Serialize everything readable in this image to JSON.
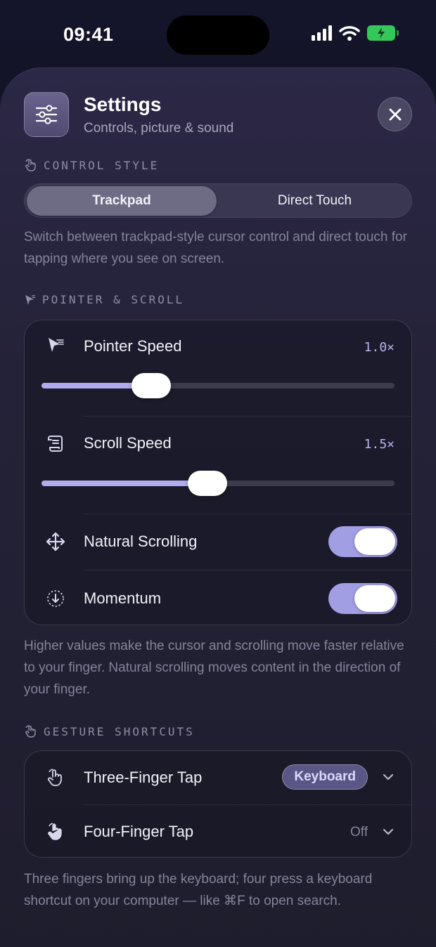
{
  "status_bar": {
    "time": "09:41"
  },
  "header": {
    "title": "Settings",
    "subtitle": "Controls, picture & sound"
  },
  "control_style": {
    "label": "CONTROL STYLE",
    "options": [
      "Trackpad",
      "Direct Touch"
    ],
    "selected": "Trackpad",
    "help": "Switch between trackpad-style cursor control and direct touch for tapping where you see on screen."
  },
  "pointer_scroll": {
    "label": "POINTER & SCROLL",
    "pointer_speed": {
      "label": "Pointer Speed",
      "value": "1.0×",
      "fraction": 0.31
    },
    "scroll_speed": {
      "label": "Scroll Speed",
      "value": "1.5×",
      "fraction": 0.47
    },
    "natural_scrolling": {
      "label": "Natural Scrolling",
      "on": true
    },
    "momentum": {
      "label": "Momentum",
      "on": true
    },
    "help": "Higher values make the cursor and scrolling move faster relative to your finger. Natural scrolling moves content in the direction of your finger."
  },
  "gesture_shortcuts": {
    "label": "GESTURE SHORTCUTS",
    "three_finger": {
      "label": "Three-Finger Tap",
      "value": "Keyboard"
    },
    "four_finger": {
      "label": "Four-Finger Tap",
      "value": "Off"
    },
    "help": "Three fingers bring up the keyboard; four press a keyboard shortcut on your computer — like ⌘F to open search."
  },
  "colors": {
    "accent": "#b1acf0",
    "toggle_on": "#a29ee3",
    "battery": "#34c759"
  }
}
